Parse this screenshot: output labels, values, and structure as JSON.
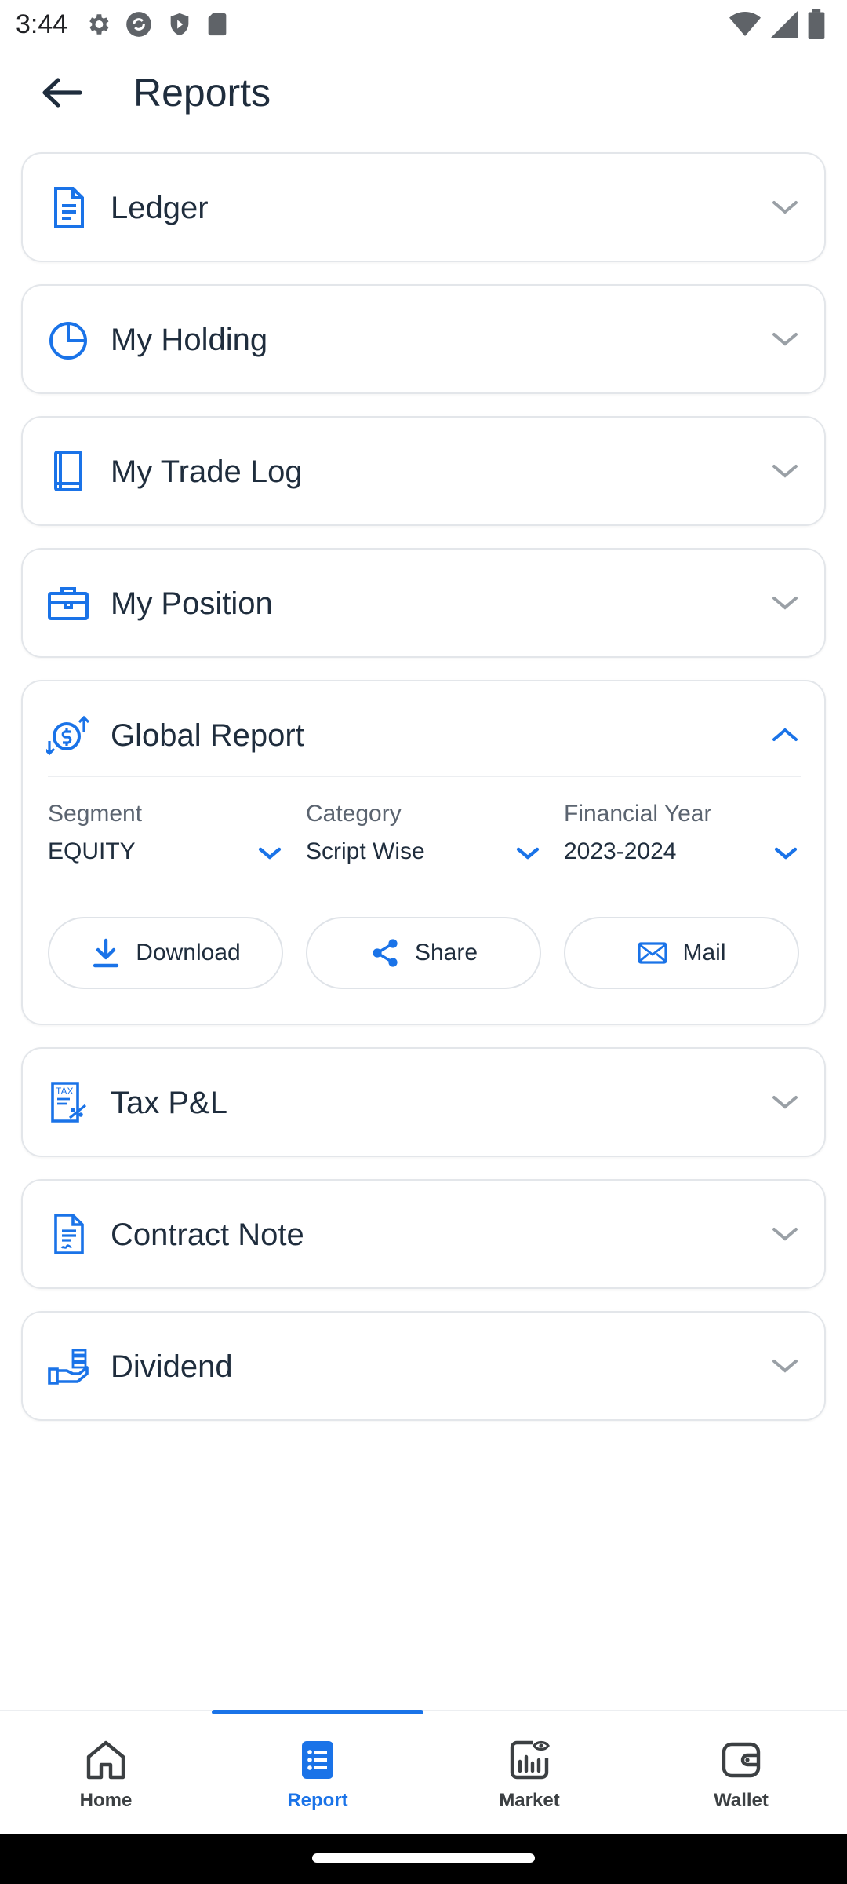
{
  "status_bar": {
    "time": "3:44",
    "left_icons": [
      "settings-icon",
      "sync-icon",
      "shield-icon",
      "sd-card-icon"
    ],
    "right_icons": [
      "wifi-icon",
      "signal-icon",
      "battery-icon"
    ]
  },
  "header": {
    "title": "Reports",
    "back_icon": "arrow-left-icon"
  },
  "accent_color": "#1a73e8",
  "cards": [
    {
      "title": "Ledger",
      "icon": "document-icon",
      "expanded": false
    },
    {
      "title": "My Holding",
      "icon": "pie-chart-icon",
      "expanded": false
    },
    {
      "title": "My Trade Log",
      "icon": "book-icon",
      "expanded": false
    },
    {
      "title": "My Position",
      "icon": "briefcase-icon",
      "expanded": false
    },
    {
      "title": "Global Report",
      "icon": "money-growth-icon",
      "expanded": true
    },
    {
      "title": "Tax P&L",
      "icon": "tax-icon",
      "expanded": false
    },
    {
      "title": "Contract Note",
      "icon": "signed-document-icon",
      "expanded": false
    },
    {
      "title": "Dividend",
      "icon": "hand-coins-icon",
      "expanded": false
    }
  ],
  "global_report": {
    "filters": [
      {
        "label": "Segment",
        "value": "EQUITY"
      },
      {
        "label": "Category",
        "value": "Script Wise"
      },
      {
        "label": "Financial Year",
        "value": "2023-2024"
      }
    ],
    "actions": [
      {
        "label": "Download",
        "icon": "download-icon"
      },
      {
        "label": "Share",
        "icon": "share-icon"
      },
      {
        "label": "Mail",
        "icon": "mail-icon"
      }
    ]
  },
  "bottom_nav": {
    "items": [
      {
        "label": "Home",
        "icon": "home-icon",
        "active": false
      },
      {
        "label": "Report",
        "icon": "report-icon",
        "active": true
      },
      {
        "label": "Market",
        "icon": "market-icon",
        "active": false
      },
      {
        "label": "Wallet",
        "icon": "wallet-icon",
        "active": false
      }
    ]
  }
}
